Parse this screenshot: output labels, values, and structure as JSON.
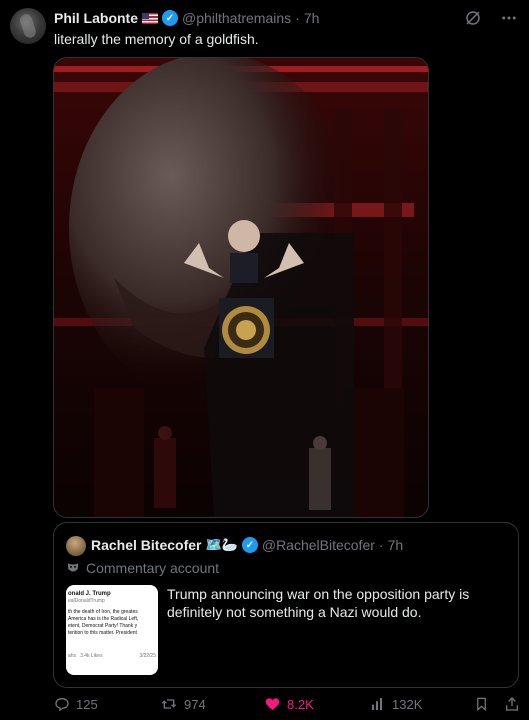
{
  "author": {
    "name": "Phil Labonte",
    "handle": "@philthatremains",
    "separator": "·",
    "time": "7h",
    "flag_icon": "us-flag-icon",
    "verified_icon": "verified-badge-icon"
  },
  "tweet": {
    "text": "literally the memory of a goldfish."
  },
  "media": {
    "alt_description": ""
  },
  "quote": {
    "name": "Rachel Bitecofer",
    "emoji": "🗺️🦢",
    "handle": "@RachelBitecofer",
    "separator": "·",
    "time": "7h",
    "commentary_label": "Commentary account",
    "text": "Trump announcing war on the opposition party is definitely not something a Nazi would do.",
    "thumbnail": {
      "name": "onald J. Trump",
      "handle": "ealDonaldTrump",
      "lines": [
        "th the death of Iron, the greates",
        "America has is the Radical Left,",
        "etent, Democrat Party! Thank y",
        "tention to this matter. President"
      ],
      "footer_left": "ahs",
      "footer_likes": "3.4k Likes",
      "footer_date": "3/22/25"
    }
  },
  "actions": {
    "replies": "125",
    "reposts": "974",
    "likes": "8.2K",
    "views": "132K"
  },
  "colors": {
    "background": "#000000",
    "text": "#e7e9ea",
    "secondary": "#71767b",
    "border": "#2f3336",
    "verified": "#1d9bf0",
    "like": "#f91880"
  }
}
